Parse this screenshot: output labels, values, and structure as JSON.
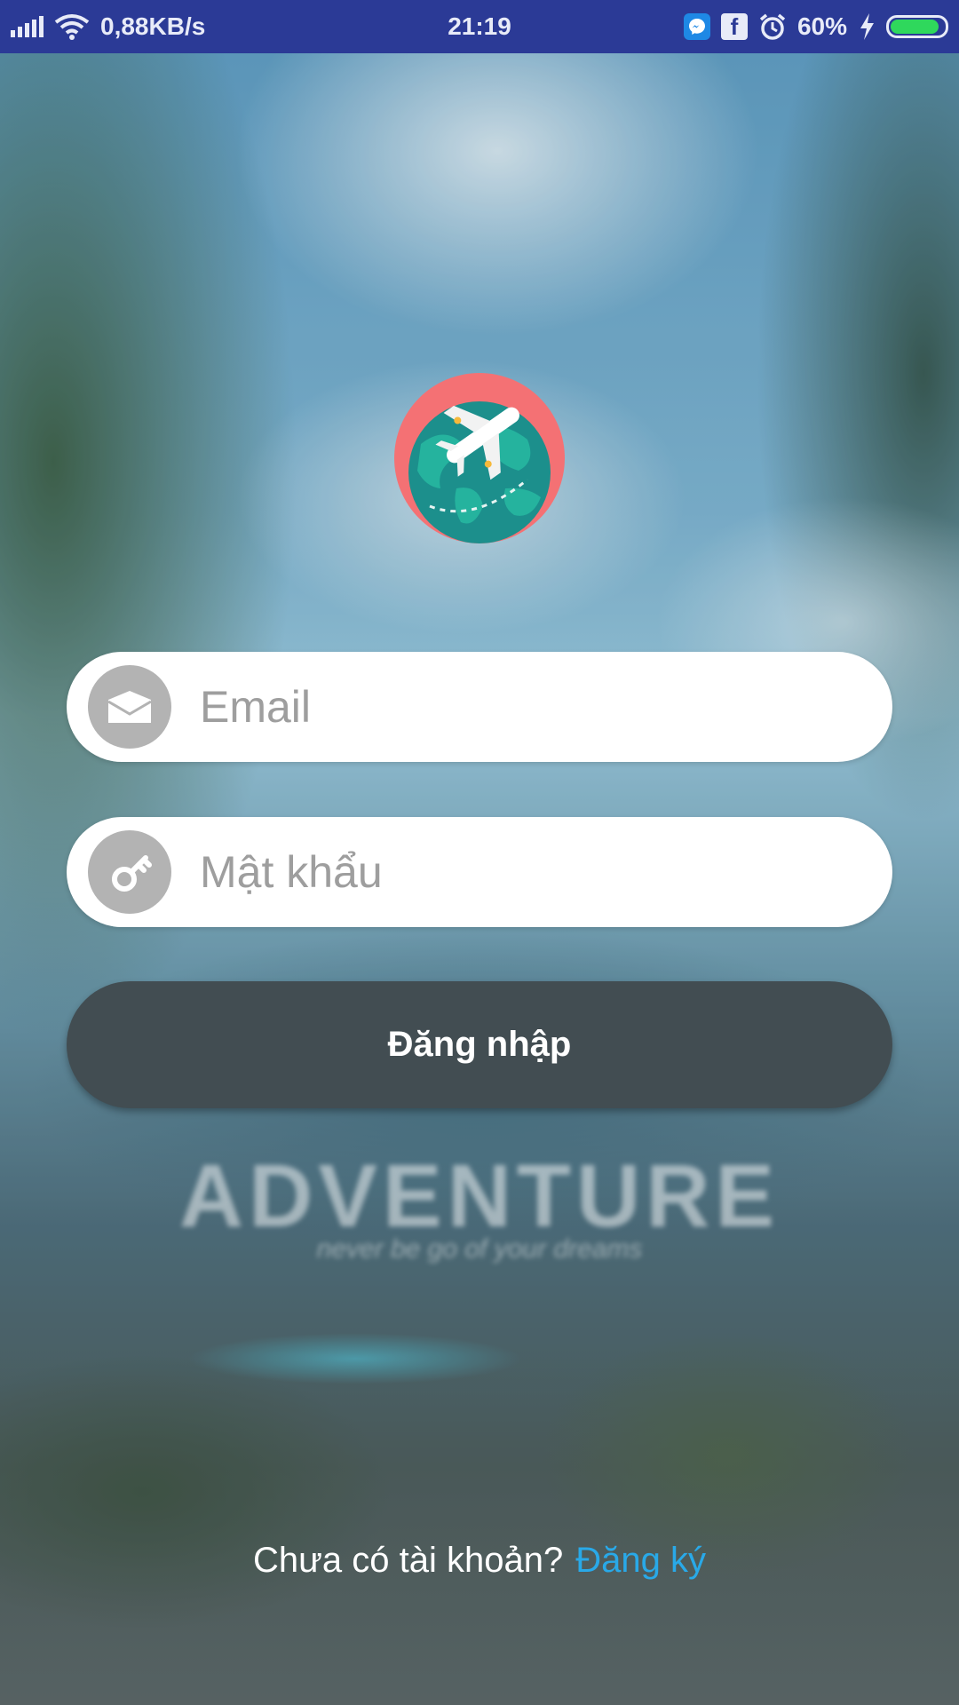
{
  "status_bar": {
    "network_speed": "0,88KB/s",
    "time": "21:19",
    "battery_percent": "60%",
    "battery_level": 0.9,
    "icons": [
      "signal-icon",
      "wifi-icon",
      "messenger-icon",
      "facebook-icon",
      "alarm-icon",
      "charging-icon",
      "battery-icon"
    ]
  },
  "background": {
    "watermark_title": "ADVENTURE",
    "watermark_subtitle": "never be go of your dreams"
  },
  "login_form": {
    "email": {
      "placeholder": "Email",
      "value": "",
      "icon": "envelope-icon"
    },
    "password": {
      "placeholder": "Mật khẩu",
      "value": "",
      "icon": "key-icon"
    },
    "login_label": "Đăng nhập"
  },
  "signup": {
    "prompt": "Chưa có tài khoản?",
    "link_label": "Đăng ký"
  },
  "colors": {
    "status_bar": "#2b3a96",
    "button": "#424d52",
    "link": "#29a9e8",
    "logo_bg": "#f47174",
    "globe": "#1c8f8c"
  }
}
